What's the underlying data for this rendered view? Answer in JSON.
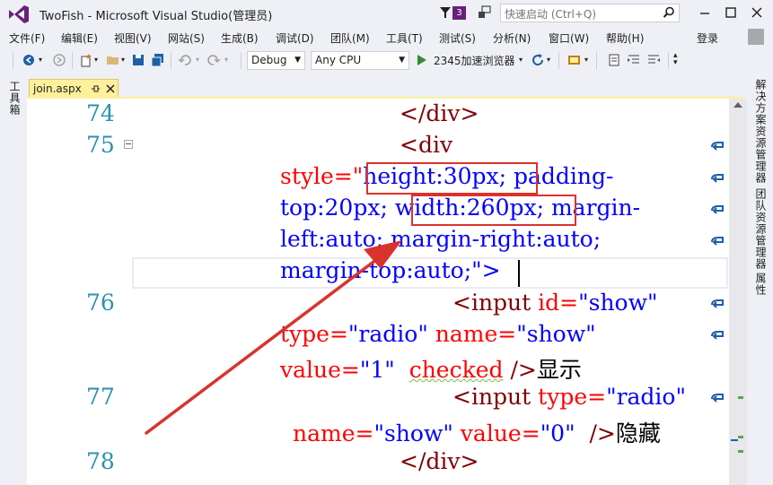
{
  "window": {
    "title": "TwoFish - Microsoft Visual Studio(管理员)",
    "notification_count": "3"
  },
  "quick_launch": {
    "placeholder": "快速启动 (Ctrl+Q)"
  },
  "menu": {
    "items": [
      "文件(F)",
      "编辑(E)",
      "视图(V)",
      "网站(S)",
      "生成(B)",
      "调试(D)",
      "团队(M)",
      "工具(T)",
      "测试(S)",
      "分析(N)",
      "窗口(W)",
      "帮助(H)"
    ],
    "sign_in": "登录"
  },
  "toolbar": {
    "config": "Debug",
    "platform": "Any CPU",
    "run_target": "2345加速浏览器"
  },
  "side_tabs": {
    "left": "工具箱",
    "right_1": "解决方案资源管理器",
    "right_2": "团队资源管理器",
    "right_3": "属性"
  },
  "document": {
    "tab_name": "join.aspx"
  },
  "editor": {
    "line_numbers": [
      "74",
      "75",
      "76",
      "77",
      "78"
    ],
    "lines": {
      "l74": "</div>",
      "l75_open": "<div",
      "l75_style_attr": "style=\"",
      "l75_height": "height:30px;",
      "l75_padding": " padding-",
      "l75_top": "top:20px; ",
      "l75_width": "width:260px;",
      "l75_margin": " margin-",
      "l75_left": "left:auto; margin-right:auto;",
      "l75_mtop": "margin-top:auto;\">",
      "l76_input": "<input",
      "l76_id_attr": " id=",
      "l76_id_val": "\"show\"",
      "l76_type_attr": "type=",
      "l76_type_val": "\"radio\"",
      "l76_name_attr": " name=",
      "l76_name_val": "\"show\"",
      "l76_value_attr": "value=",
      "l76_value_val": "\"1\"",
      "l76_checked": "checked",
      "l76_close": " />",
      "l76_text": "显示",
      "l77_input": "<input",
      "l77_type_attr": " type=",
      "l77_type_val": "\"radio\"",
      "l77_name_attr": "name=",
      "l77_name_val": "\"show\"",
      "l77_value_attr": " value=",
      "l77_value_val": "\"0\"",
      "l77_close": "  />",
      "l77_text": "隐藏",
      "l78": "</div>"
    }
  },
  "colors": {
    "tag": "#800000",
    "attr": "#ff0000",
    "value": "#0000ff",
    "line_number": "#2b91af",
    "annotation": "#d9332e",
    "vs_purple": "#68217a"
  }
}
